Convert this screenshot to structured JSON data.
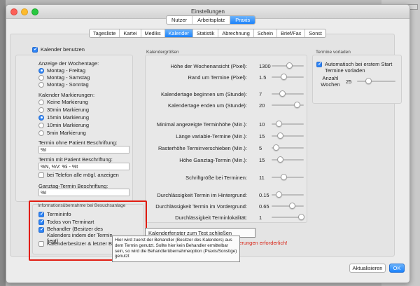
{
  "window": {
    "title": "Einstellungen"
  },
  "toptabs": [
    "Nutzer",
    "Arbeitsplatz",
    "Praxis"
  ],
  "subtabs": [
    "Tagesliste",
    "Kartei",
    "Mediks",
    "Kalender",
    "Statistik",
    "Abrechnung",
    "Schein",
    "Brief/Fax",
    "Sonst"
  ],
  "left": {
    "kalender_benutzen": "Kalender benutzen",
    "anzeige_title": "Anzeige der Wochentage:",
    "anzeige_options": [
      "Montag - Freitag",
      "Montag - Samstag",
      "Montag - Sonntag"
    ],
    "markierungen_title": "Kalender Markierungen:",
    "markierungen_options": [
      "Keine Markierung",
      "30min Markierung",
      "15min Markierung",
      "10min Markierung",
      "5min Markierung"
    ],
    "ohne_patient_label": "Termin ohne Patient Beschriftung:",
    "ohne_patient_value": "%I",
    "mit_patient_label": "Termin mit Patient Beschriftung:",
    "mit_patient_value": "%N, %V: %i - %t",
    "telefon_label": "bei Telefon alle mögl. anzeigen",
    "ganztag_label": "Ganztag-Termin Beschriftung:",
    "ganztag_value": "%I"
  },
  "info": {
    "title": "Informationsübernahme bei Besuchsanlage",
    "items": [
      "Termininfo",
      "Todos von Terminart",
      "Behandler (Besitzer des Kalenders indem der Termin liegt)",
      "Kalenderbesitzer & letzter Bel"
    ]
  },
  "mid": {
    "title": "Kalendergrößen",
    "rows": [
      {
        "label": "Höhe der Wochenansicht (Pixel):",
        "value": "1300",
        "pos": 0.55
      },
      {
        "label": "Rand um Termine (Pixel):",
        "value": "1.5",
        "pos": 0.35
      },
      {
        "label": "Kalendertage beginnen um (Stunde):",
        "value": "7",
        "pos": 0.3
      },
      {
        "label": "Kalendertage enden um (Stunde):",
        "value": "20",
        "pos": 0.85
      },
      {
        "label": "Minimal angezeigte Terminhöhe (Min.):",
        "value": "10",
        "pos": 0.15
      },
      {
        "label": "Länge variable-Termine (Min.):",
        "value": "15",
        "pos": 0.2
      },
      {
        "label": "Rasterhöhe Terminverschieben (Min.):",
        "value": "5",
        "pos": 0.05
      },
      {
        "label": "Höhe Ganztag-Termin (Min.):",
        "value": "15",
        "pos": 0.2
      },
      {
        "label": "Schriftgröße bei Terminen:",
        "value": "11",
        "pos": 0.35
      },
      {
        "label": "Durchlässigkeit Termin im Hintergrund:",
        "value": "0.15",
        "pos": 0.15
      },
      {
        "label": "Durchlässigkeit Termin im Vordergrund:",
        "value": "0.65",
        "pos": 0.65
      },
      {
        "label": "Durchlässigkeit Terminlokalität:",
        "value": "1",
        "pos": 1.0
      }
    ]
  },
  "right": {
    "title": "Termine vorladen",
    "auto_label": "Automatisch bei erstem Start Termine vorladen",
    "anzahl_label": "Anzahl Wochen",
    "anzahl_value": "25",
    "anzahl_pos": 0.25
  },
  "tooltip1": "Kalenderfenster zum Test schließen",
  "tooltip2": "Hier wird zuerst der Behandler (Besitzer des Kalenders) aus dem Termin genutzt. Sollte hier kein Behandler ermittelbar sein, so wird die Behandlerübernahmeoption (Praxis/Sonstige) genutzt",
  "warning": "derungen erforderlich!",
  "buttons": {
    "refresh": "Aktualisieren",
    "ok": "OK"
  }
}
